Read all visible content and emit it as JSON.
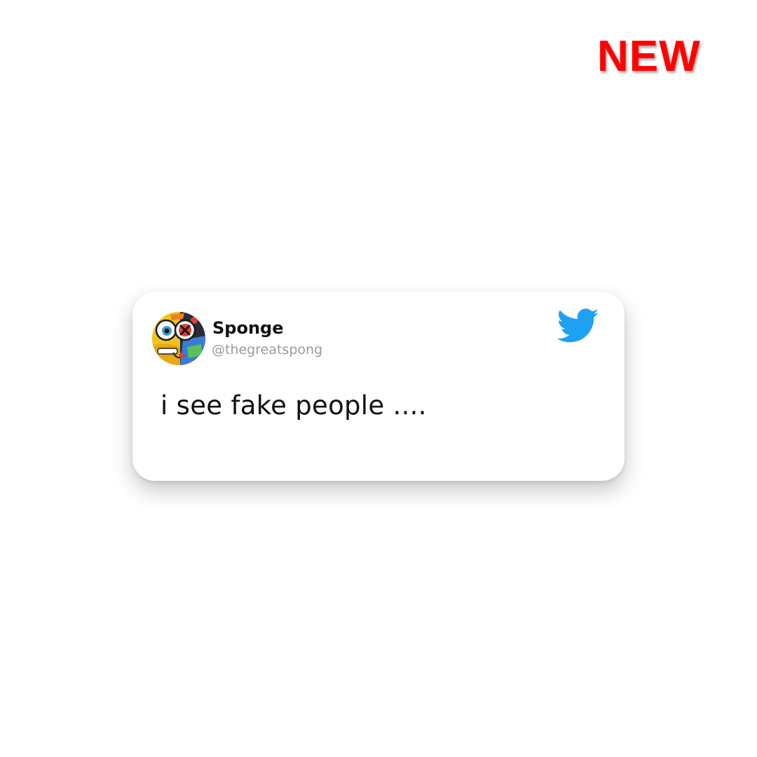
{
  "badge": {
    "label": "NEW",
    "color": "#ff0000"
  },
  "tweet": {
    "display_name": "Sponge",
    "handle": "@thegreatspong",
    "text": "i see fake people ....",
    "avatar_icon": "cartoon-sponge-avatar",
    "brand_icon": "twitter-bird-icon",
    "brand_color": "#1da1f2"
  }
}
